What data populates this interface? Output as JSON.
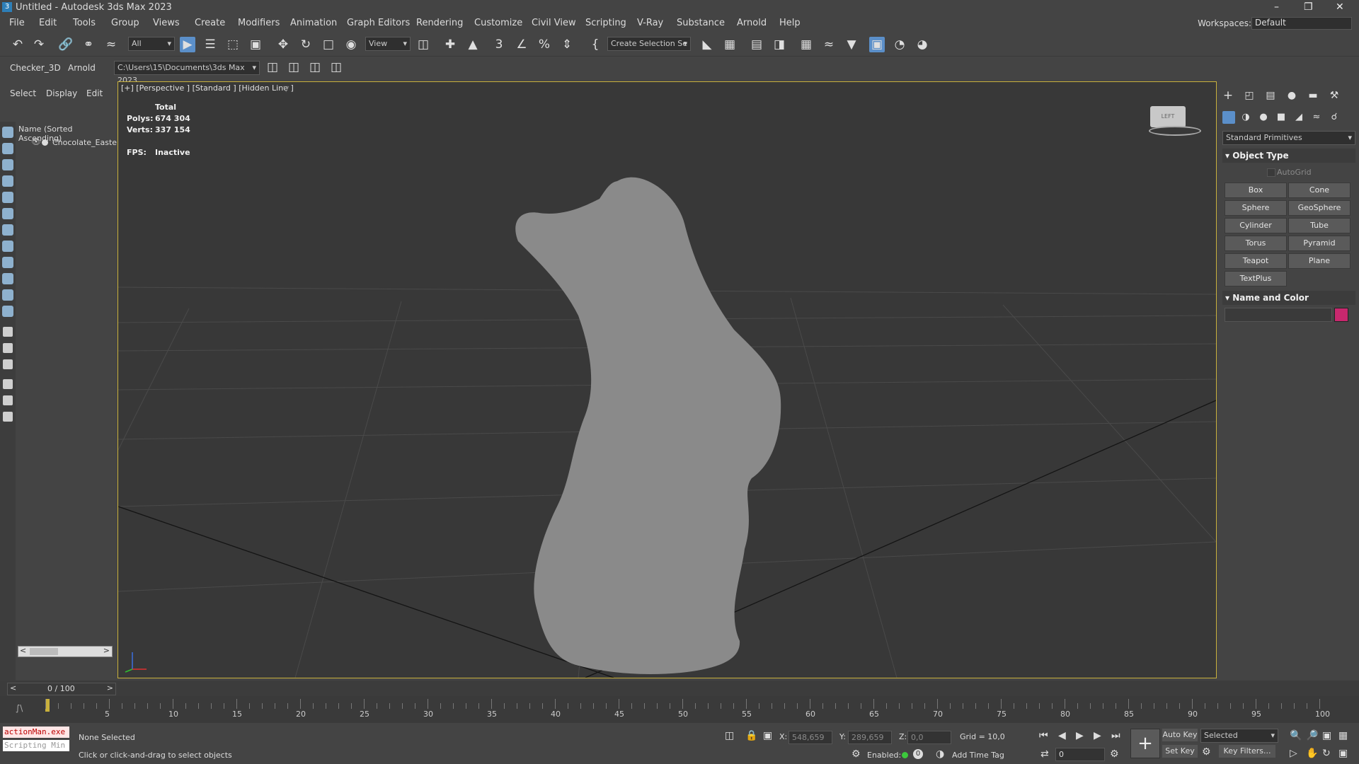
{
  "window": {
    "title": "Untitled - Autodesk 3ds Max 2023",
    "logo_text": "3",
    "minimize": "–",
    "restore": "❐",
    "close": "✕"
  },
  "menu": [
    "File",
    "Edit",
    "Tools",
    "Group",
    "Views",
    "Create",
    "Modifiers",
    "Animation",
    "Graph Editors",
    "Rendering",
    "Customize",
    "Civil View",
    "Scripting",
    "V-Ray",
    "Substance",
    "Arnold",
    "Help"
  ],
  "workspaces": {
    "label": "Workspaces:",
    "value": "Default"
  },
  "toolbar": {
    "filter_value": "All",
    "ref_coord_value": "View",
    "selection_set_value": "Create Selection Se",
    "snaps_label": "3",
    "angle_snap_label": "∠"
  },
  "toolbar2": {
    "tabs": [
      "Checker_3D",
      "Arnold"
    ],
    "project_path": "C:\\Users\\15\\Documents\\3ds Max 2023"
  },
  "scene_explorer": {
    "tabs": [
      "Select",
      "Display",
      "Edit"
    ],
    "column_header": "Name (Sorted Ascending)",
    "items": [
      {
        "name": "Chocolate_Easte"
      }
    ]
  },
  "viewport": {
    "label": "[+] [Perspective ] [Standard ] [Hidden Line ]",
    "stats": {
      "header": "Total",
      "polys_label": "Polys:",
      "polys": "674 304",
      "verts_label": "Verts:",
      "verts": "337 154",
      "fps_label": "FPS:",
      "fps": "Inactive"
    },
    "viewcube_text": "LEFT"
  },
  "command_panel": {
    "category_dropdown": "Standard Primitives",
    "object_type_title": "Object Type",
    "autogrid_label": "AutoGrid",
    "buttons": [
      "Box",
      "Cone",
      "Sphere",
      "GeoSphere",
      "Cylinder",
      "Tube",
      "Torus",
      "Pyramid",
      "Teapot",
      "Plane",
      "TextPlus"
    ],
    "name_color_title": "Name and Color",
    "object_color": "#c8286e"
  },
  "timeline": {
    "frame_display": "0 / 100",
    "ticks": [
      "5",
      "10",
      "15",
      "20",
      "25",
      "30",
      "35",
      "40",
      "45",
      "50",
      "55",
      "60",
      "65",
      "70",
      "75",
      "80",
      "85",
      "90",
      "95",
      "100"
    ]
  },
  "status": {
    "maxscript_cmd": "actionMan.exe",
    "maxscript_placeholder": "Scripting Min",
    "selection": "None Selected",
    "prompt": "Click or click-and-drag to select objects",
    "x_label": "X:",
    "x_value": "548,659",
    "y_label": "Y:",
    "y_value": "289,659",
    "z_label": "Z:",
    "z_value": "0,0",
    "grid": "Grid = 10,0",
    "enabled_label": "Enabled:",
    "add_time_tag": "Add Time Tag",
    "auto_key": "Auto Key",
    "set_key": "Set Key",
    "key_mode_value": "Selected",
    "key_filters": "Key Filters...",
    "frame_value": "0"
  }
}
